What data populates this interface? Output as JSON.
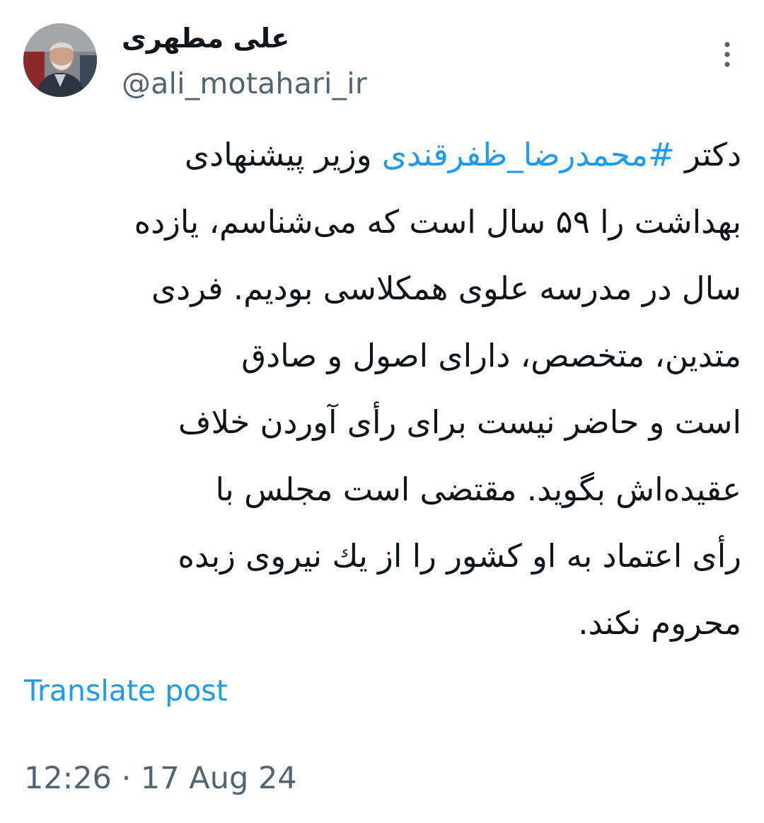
{
  "author": {
    "display_name": "علی مطهری",
    "handle": "@ali_motahari_ir"
  },
  "tweet": {
    "lines": [
      {
        "before": "دکتر ",
        "hashtag": "#محمدرضا_ظفرقندی",
        "after": " وزیر پیشنهادی"
      },
      {
        "text": "بهداشت را ۵۹ سال است که می‌شناسم، یازده"
      },
      {
        "text": "سال در مدرسه علوی همکلاسی بودیم. فردی"
      },
      {
        "text": "متدین، متخصص، دارای اصول و صادق"
      },
      {
        "text": "است و حاضر نیست برای رأی آوردن خلاف"
      },
      {
        "text": "عقیده‌اش بگوید. مقتضی است مجلس با"
      },
      {
        "text": "رأی اعتماد به او کشور را از یك نیروی زبده"
      },
      {
        "text": "محروم نکند."
      }
    ]
  },
  "actions": {
    "translate_label": "Translate post"
  },
  "meta": {
    "timestamp": "12:26 · 17 Aug 24"
  },
  "icons": {
    "more": "more-vertical-icon",
    "avatar": "avatar-photo"
  },
  "colors": {
    "link": "#1d9bf0",
    "secondary_text": "#536471",
    "primary_text": "#0f1419"
  }
}
